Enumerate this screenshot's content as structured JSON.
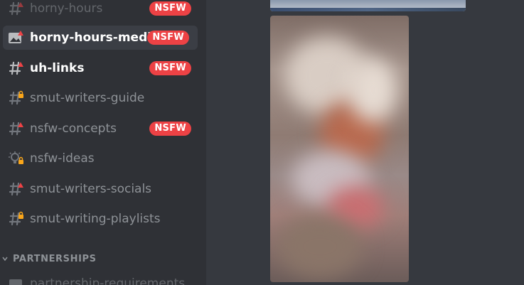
{
  "sidebar": {
    "channels": [
      {
        "name": "horny-hours",
        "icon": "text-channel-nsfw-icon",
        "badge": "NSFW"
      },
      {
        "name": "horny-hours-media",
        "icon": "image-channel-nsfw-icon",
        "badge": "NSFW",
        "selected": true
      },
      {
        "name": "uh-links",
        "icon": "text-channel-nsfw-icon",
        "badge": "NSFW",
        "unread": true
      },
      {
        "name": "smut-writers-guide",
        "icon": "text-channel-locked-icon"
      },
      {
        "name": "nsfw-concepts",
        "icon": "text-channel-nsfw-icon",
        "badge": "NSFW"
      },
      {
        "name": "nsfw-ideas",
        "icon": "forum-channel-locked-icon"
      },
      {
        "name": "smut-writers-socials",
        "icon": "text-channel-nsfw-icon"
      },
      {
        "name": "smut-writing-playlists",
        "icon": "text-channel-locked-icon"
      }
    ],
    "category": {
      "label": "PARTNERSHIPS"
    },
    "partial_channel": {
      "name": "partnership-requirements",
      "icon": "text-channel-icon"
    }
  },
  "colors": {
    "sidebar_bg": "#2f3136",
    "chat_bg": "#36393f",
    "nsfw_badge": "#ed4245",
    "muted_text": "#8e9297",
    "lock_accent": "#faa61a"
  },
  "media": [
    {
      "name": "media-attachment-top",
      "state": "blurred"
    },
    {
      "name": "media-attachment-main",
      "state": "blurred"
    }
  ]
}
